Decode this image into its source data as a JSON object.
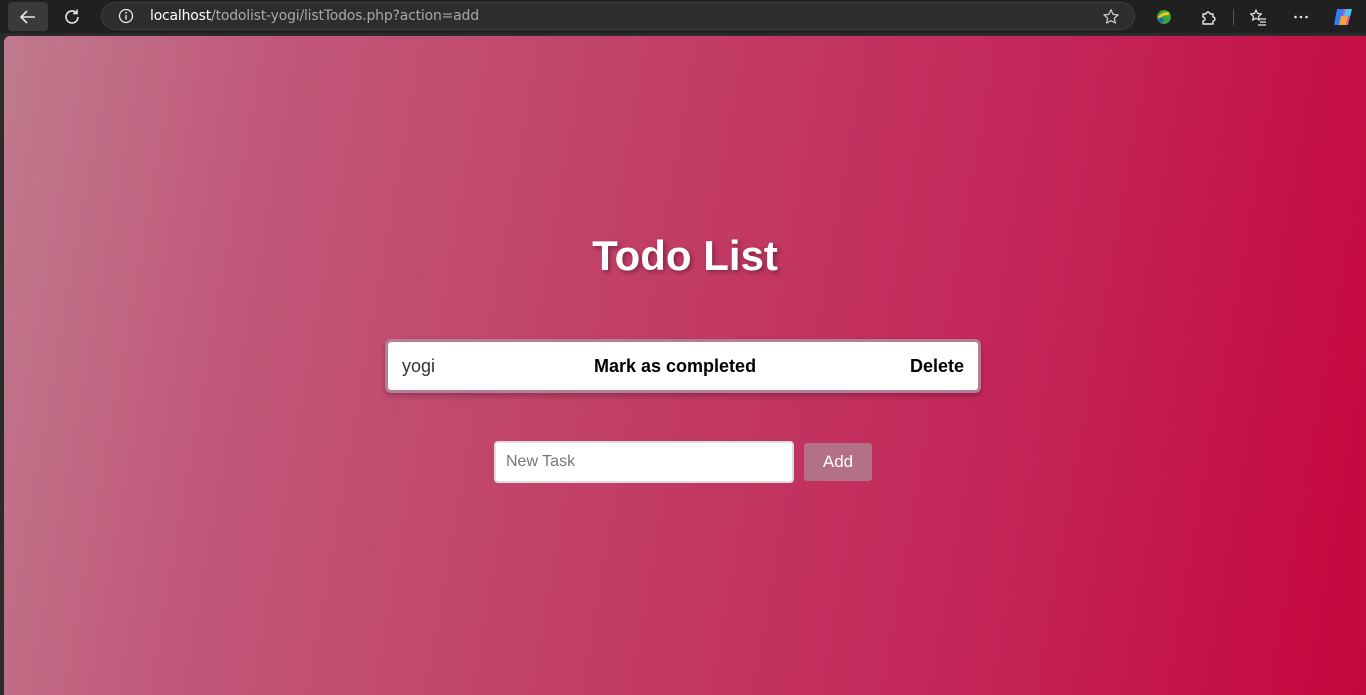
{
  "browser": {
    "url_host": "localhost",
    "url_path": "/todolist-yogi/listTodos.php?action=add",
    "icons": [
      "back-icon",
      "refresh-icon",
      "site-info-icon",
      "star-icon",
      "extension-app-icon",
      "extensions-icon",
      "favorites-icon",
      "more-icon",
      "copilot-icon"
    ]
  },
  "page": {
    "title": "Todo List",
    "todos": [
      {
        "task": "yogi",
        "complete_label": "Mark as completed",
        "delete_label": "Delete"
      }
    ],
    "new_task": {
      "placeholder": "New Task",
      "value": ""
    },
    "add_label": "Add"
  },
  "colors": {
    "gradient_start": "#c07a8e",
    "gradient_end": "#c4063e",
    "add_button": "#b37187"
  }
}
